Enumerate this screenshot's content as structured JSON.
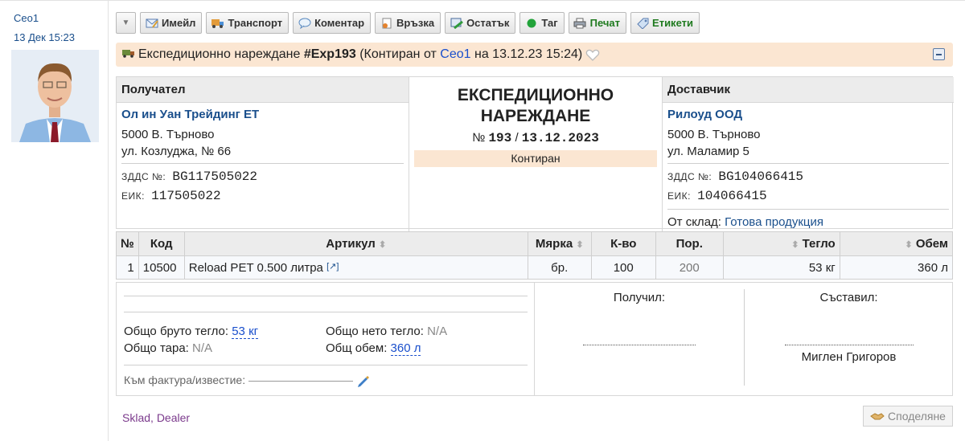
{
  "sidebar": {
    "author": "Ceo1",
    "datetime": "13 Дек 15:23"
  },
  "toolbar": {
    "email": "Имейл",
    "transport": "Транспорт",
    "comment": "Коментар",
    "link": "Връзка",
    "remainder": "Остатък",
    "tag": "Таг",
    "print": "Печат",
    "labels": "Етикети"
  },
  "title_bar": {
    "prefix": "Експедиционно нареждане",
    "code": "#Exp193",
    "status_open": "(Контиран от",
    "user": "Ceo1",
    "date_part": "на 13.12.23 15:24)"
  },
  "recipient": {
    "heading": "Получател",
    "name": "Ол ин Уан Трейдинг ЕТ",
    "address1": "5000 В. Търново",
    "address2": "ул. Козлуджа, № 66",
    "vat_label": "ЗДДС №:",
    "vat": "BG117505022",
    "eik_label": "ЕИК:",
    "eik": "117505022"
  },
  "document": {
    "title_line1": "ЕКСПЕДИЦИОННО",
    "title_line2": "НАРЕЖДАНЕ",
    "no_label": "№",
    "number": "193",
    "slash": "/",
    "date": "13.12.2023",
    "state": "Контиран"
  },
  "supplier": {
    "heading": "Доставчик",
    "name": "Рилоуд ООД",
    "address1": "5000 В. Търново",
    "address2": "ул. Маламир 5",
    "vat_label": "ЗДДС №:",
    "vat": "BG104066415",
    "eik_label": "ЕИК:",
    "eik": "104066415",
    "store_label": "От склад:",
    "store": "Готова продукция"
  },
  "items": {
    "headers": {
      "no": "№",
      "code": "Код",
      "article": "Артикул",
      "unit": "Мярка",
      "qty": "К-во",
      "order": "Пор.",
      "weight": "Тегло",
      "volume": "Обем"
    },
    "rows": [
      {
        "no": "1",
        "code": "10500",
        "article": "Reload PET 0.500 литра",
        "ext": "[↗]",
        "unit": "бр.",
        "qty": "100",
        "order": "200",
        "weight": "53 кг",
        "volume": "360 л"
      }
    ]
  },
  "totals": {
    "gross_label": "Общо бруто тегло:",
    "gross": "53 кг",
    "net_label": "Общо нето тегло:",
    "net": "N/A",
    "tare_label": "Общо тара:",
    "tare": "N/A",
    "volume_label": "Общ обем:",
    "volume": "360 л",
    "invoice_label": "Към фактура/известие:"
  },
  "signatures": {
    "received_label": "Получил:",
    "compiled_label": "Съставил:",
    "compiled_name": "Миглен Григоров"
  },
  "footer": {
    "tag1": "Sklad",
    "tag2": "Dealer",
    "share": "Споделяне"
  },
  "colors": {
    "accent_link": "#1a4f8c",
    "status_bg": "#fbe6d2",
    "header_bg": "#ececec",
    "tag_color": "#7b3a8c"
  }
}
